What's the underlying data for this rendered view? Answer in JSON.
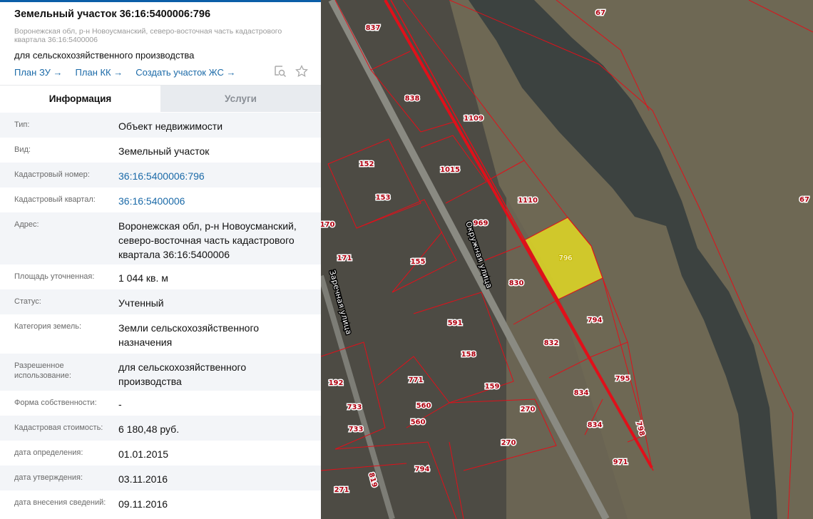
{
  "header": {
    "title": "Земельный участок 36:16:5400006:796",
    "address": "Воронежская обл, р-н Новоусманский, северо-восточная часть кадастрового квартала 36:16:5400006",
    "purpose": "для сельскохозяйственного производства",
    "links": [
      "План ЗУ →",
      "План КК →",
      "Создать участок ЖС →"
    ]
  },
  "tabs": [
    {
      "label": "Информация",
      "active": true
    },
    {
      "label": "Услуги",
      "active": false
    }
  ],
  "rows": [
    {
      "label": "Тип:",
      "value": "Объект недвижимости"
    },
    {
      "label": "Вид:",
      "value": "Земельный участок"
    },
    {
      "label": "Кадастровый номер:",
      "value": "36:16:5400006:796",
      "link": true
    },
    {
      "label": "Кадастровый квартал:",
      "value": "36:16:5400006",
      "link": true
    },
    {
      "label": "Адрес:",
      "value": "Воронежская обл, р-н Новоусманский, северо-восточная часть кадастрового квартала 36:16:5400006"
    },
    {
      "label": "Площадь уточненная:",
      "value": "1 044 кв. м"
    },
    {
      "label": "Статус:",
      "value": "Учтенный"
    },
    {
      "label": "Категория земель:",
      "value": "Земли сельскохозяйственного назначения"
    },
    {
      "label": "Разрешенное использование:",
      "value": "для сельскохозяйственного производства"
    },
    {
      "label": "Форма собственности:",
      "value": "-"
    },
    {
      "label": "Кадастровая стоимость:",
      "value": "6 180,48 руб."
    },
    {
      "label": "дата определения:",
      "value": "01.01.2015"
    },
    {
      "label": "дата утверждения:",
      "value": "03.11.2016"
    },
    {
      "label": "дата внесения сведений:",
      "value": "09.11.2016"
    }
  ],
  "map": {
    "selected_parcel": "796",
    "highlight_color": "#e8e020",
    "boundary_color": "#e0101a",
    "parcel_labels": [
      "837",
      "838",
      "1109",
      "152",
      "1015",
      "153",
      "1110",
      "170",
      "969",
      "796",
      "171",
      "155",
      "830",
      "794",
      "591",
      "832",
      "158",
      "795",
      "771",
      "159",
      "192",
      "834",
      "733",
      "560",
      "270",
      "560",
      "834",
      "733",
      "798",
      "270",
      "971",
      "794",
      "819",
      "271",
      "67",
      "67"
    ],
    "streets": [
      "Окружная улица",
      "Заречная улица"
    ]
  }
}
